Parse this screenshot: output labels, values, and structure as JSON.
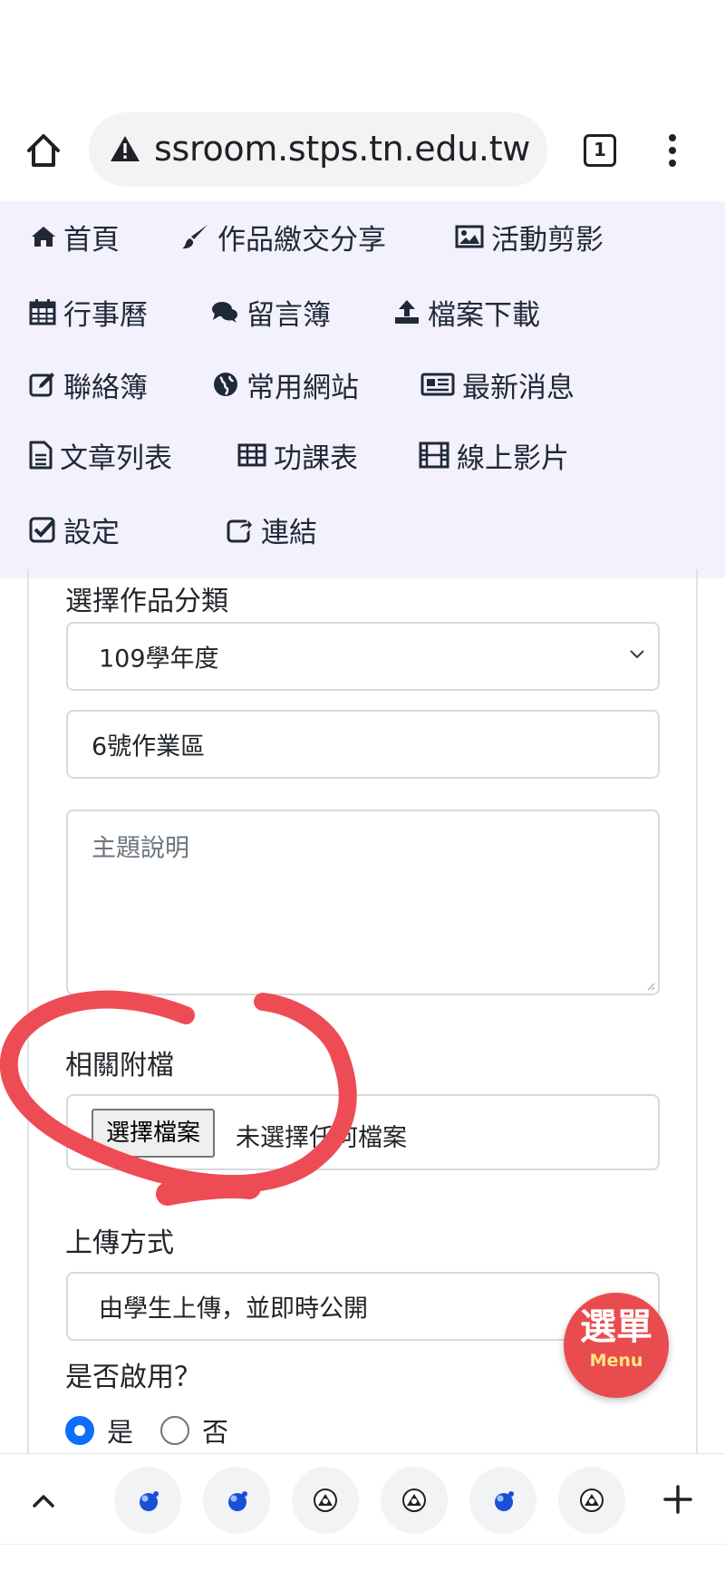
{
  "browser": {
    "url": "ssroom.stps.tn.edu.tw",
    "tab_count": "1"
  },
  "nav": {
    "items": [
      {
        "label": "首頁",
        "icon": "home-icon"
      },
      {
        "label": "作品繳交分享",
        "icon": "paintbrush-icon"
      },
      {
        "label": "活動剪影",
        "icon": "image-icon"
      },
      {
        "label": "行事曆",
        "icon": "calendar-icon"
      },
      {
        "label": "留言簿",
        "icon": "comments-icon"
      },
      {
        "label": "檔案下載",
        "icon": "upload-icon"
      },
      {
        "label": "聯絡簿",
        "icon": "edit-icon"
      },
      {
        "label": "常用網站",
        "icon": "globe-icon"
      },
      {
        "label": "最新消息",
        "icon": "newspaper-icon"
      },
      {
        "label": "文章列表",
        "icon": "file-text-icon"
      },
      {
        "label": "功課表",
        "icon": "table-icon"
      },
      {
        "label": "線上影片",
        "icon": "film-icon"
      },
      {
        "label": "設定",
        "icon": "check-square-icon"
      },
      {
        "label": "連結",
        "icon": "share-icon"
      }
    ]
  },
  "form": {
    "category_label": "選擇作品分類",
    "year_select": "109學年度",
    "work_area": "6號作業區",
    "description_placeholder": "主題說明",
    "attachment_label": "相關附檔",
    "file_button": "選擇檔案",
    "file_status": "未選擇任何檔案",
    "upload_method_label": "上傳方式",
    "upload_method_value": "由學生上傳，並即時公開",
    "enable_label": "是否啟用？",
    "enable_yes": "是",
    "enable_no": "否"
  },
  "fab": {
    "title": "選單",
    "subtitle": "Menu"
  },
  "colors": {
    "nav_background": "#f3f1fd",
    "annotation": "#ee4c55",
    "fab": "#e84c4f",
    "radio_active": "#0d6efd"
  }
}
